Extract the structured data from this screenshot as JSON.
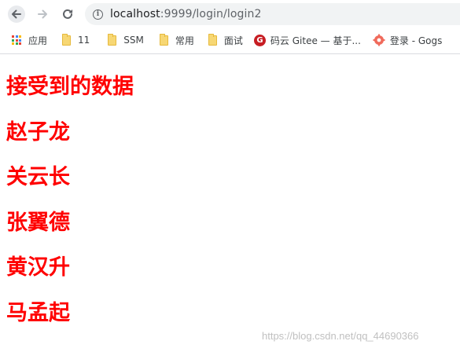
{
  "browser": {
    "url_host": "localhost",
    "url_path": ":9999/login/login2",
    "bookmarks": [
      {
        "label": "应用",
        "icon": "apps-grid-icon"
      },
      {
        "label": "11",
        "icon": "folder-icon"
      },
      {
        "label": "SSM",
        "icon": "folder-icon"
      },
      {
        "label": "常用",
        "icon": "folder-icon"
      },
      {
        "label": "面试",
        "icon": "folder-icon"
      },
      {
        "label": "码云 Gitee — 基于...",
        "icon": "gitee-icon"
      },
      {
        "label": "登录 - Gogs",
        "icon": "gogs-icon"
      }
    ]
  },
  "page": {
    "headings": [
      "接受到的数据",
      "赵子龙",
      "关云长",
      "张翼德",
      "黄汉升",
      "马孟起"
    ]
  },
  "watermark": "https://blog.csdn.net/qq_44690366",
  "colors": {
    "heading": "#ff0000",
    "gitee": "#c71d23"
  }
}
